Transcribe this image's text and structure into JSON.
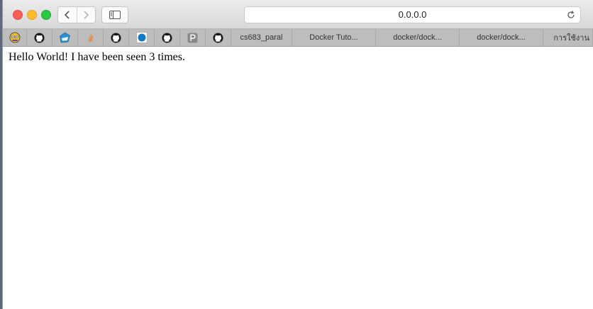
{
  "browser": {
    "url": "0.0.0.0"
  },
  "bookmarks": [
    {
      "type": "icon",
      "icon": "owl-icon"
    },
    {
      "type": "icon",
      "icon": "github-icon"
    },
    {
      "type": "icon",
      "icon": "docker-icon"
    },
    {
      "type": "icon",
      "icon": "stackoverflow-icon"
    },
    {
      "type": "icon",
      "icon": "github-icon"
    },
    {
      "type": "icon",
      "icon": "blue-circle-icon"
    },
    {
      "type": "icon",
      "icon": "github-icon"
    },
    {
      "type": "icon",
      "icon": "p-icon"
    },
    {
      "type": "icon",
      "icon": "github-icon"
    },
    {
      "type": "text",
      "label": "cs683_paral"
    },
    {
      "type": "text",
      "label": "Docker Tuto..."
    },
    {
      "type": "text",
      "label": "docker/dock..."
    },
    {
      "type": "text",
      "label": "docker/dock..."
    },
    {
      "type": "text",
      "label": "การใช้งาน"
    }
  ],
  "page": {
    "message": "Hello World! I have been seen 3 times."
  },
  "colors": {
    "close": "#fc5f57",
    "minimize": "#fdbc2e",
    "zoom": "#28c840",
    "bookmarks_bar": "#bdbdbd"
  }
}
